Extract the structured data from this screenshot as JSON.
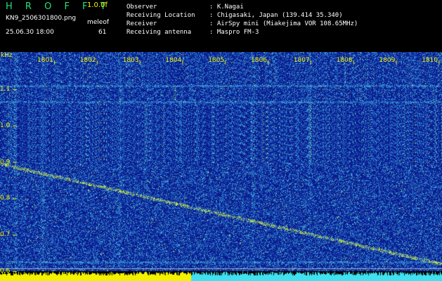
{
  "header": {
    "app_name": "H R O F F T",
    "version": "1.0.0f",
    "filename": "KN9_2506301800.png",
    "app_label": "meleof",
    "datetime": "25.06.30 18:00",
    "count": "61",
    "info": [
      {
        "label": "Observer",
        "value": ": K.Nagai"
      },
      {
        "label": "Receiving Location",
        "value": ": Chigasaki, Japan (139.414 35.340)"
      },
      {
        "label": "Receiver",
        "value": ": AirSpy mini (Miakejima VOR 108.65MHz)"
      },
      {
        "label": "Receiving antenna",
        "value": ": Maspro FM-3"
      }
    ]
  },
  "axis": {
    "unit": "kHz",
    "y_ticks": [
      "1.1",
      "1.0",
      "0.9",
      "0.8",
      "0.7",
      "0.6"
    ],
    "y_values": [
      1.1,
      1.0,
      0.9,
      0.8,
      0.7,
      0.6
    ],
    "x_ticks": [
      "1801",
      "1802",
      "1803",
      "1804",
      "1805",
      "1806",
      "1807",
      "1808",
      "1809",
      "1810"
    ],
    "x_values": [
      1801,
      1802,
      1803,
      1804,
      1805,
      1806,
      1807,
      1808,
      1809,
      1810
    ]
  },
  "colors": {
    "background": "#0a1a8c",
    "noise": "#3fb0d8",
    "trace": "#c8e040",
    "label": "#f2f200",
    "bar_left": "#f2f200",
    "bar_right": "#40e0f0"
  }
}
